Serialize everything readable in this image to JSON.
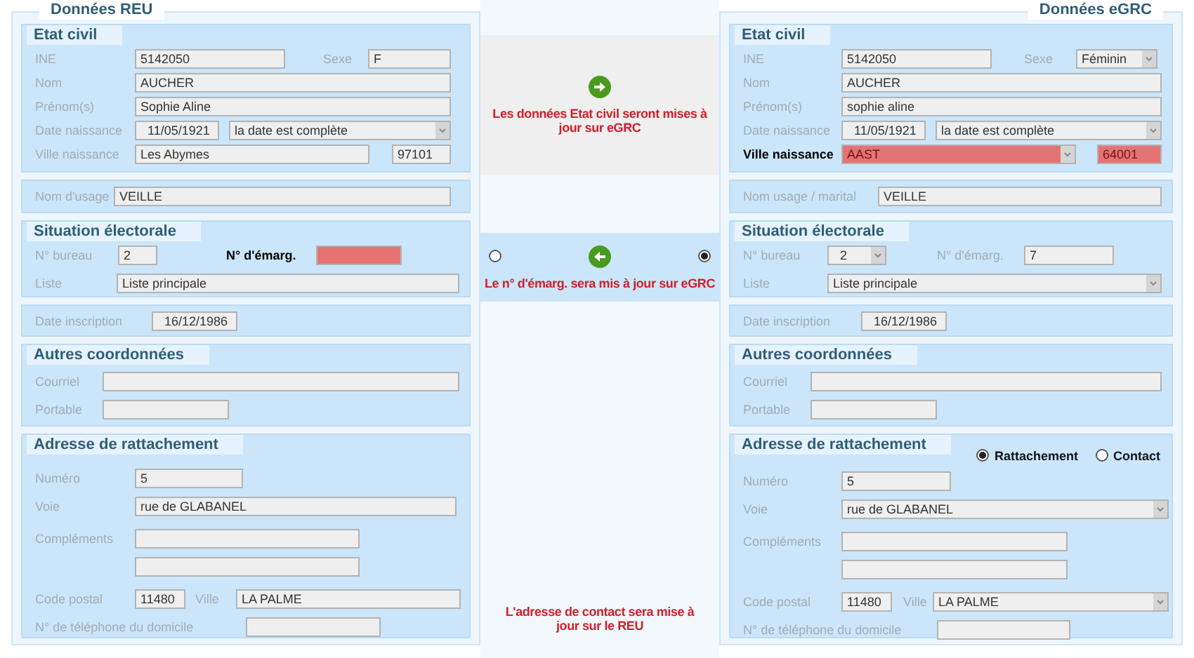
{
  "reu": {
    "title": "Données REU",
    "etat_civil": {
      "title": "Etat civil",
      "ine": {
        "label": "INE",
        "value": "5142050"
      },
      "sexe": {
        "label": "Sexe",
        "value": "F"
      },
      "nom": {
        "label": "Nom",
        "value": "AUCHER"
      },
      "prenoms": {
        "label": "Prénom(s)",
        "value": "Sophie Aline"
      },
      "date_naissance": {
        "label": "Date naissance",
        "value": "11/05/1921",
        "precision": "la date est complète"
      },
      "ville_naissance": {
        "label": "Ville naissance",
        "value": "Les Abymes",
        "code": "97101",
        "highlighted": false
      }
    },
    "nom_usage": {
      "label": "Nom d'usage",
      "value": "VEILLE"
    },
    "situation": {
      "title": "Situation électorale",
      "bureau": {
        "label": "N° bureau",
        "value": "2"
      },
      "emargement": {
        "label": "N° d'émarg.",
        "highlighted": true
      },
      "liste": {
        "label": "Liste",
        "value": "Liste principale"
      }
    },
    "date_inscription": {
      "label": "Date inscription",
      "value": "16/12/1986"
    },
    "autres": {
      "title": "Autres coordonnées",
      "courriel": {
        "label": "Courriel"
      },
      "portable": {
        "label": "Portable"
      }
    },
    "adresse": {
      "title": "Adresse de rattachement",
      "numero": {
        "label": "Numéro",
        "value": "5"
      },
      "voie": {
        "label": "Voie",
        "value": "rue de GLABANEL"
      },
      "complements": {
        "label": "Compléments"
      },
      "code_postal": {
        "label": "Code postal",
        "value": "11480"
      },
      "ville": {
        "label": "Ville",
        "value": "LA PALME"
      },
      "telephone": {
        "label": "N° de téléphone du domicile"
      }
    }
  },
  "actions": {
    "etat_civil": {
      "message": "Les données Etat civil seront mises à jour sur eGRC"
    },
    "emargement": {
      "message": "Le n° d'émarg. sera mis à jour sur eGRC",
      "options": [
        {
          "selected": false
        },
        {
          "selected": true
        }
      ]
    },
    "adresse": {
      "message": "L'adresse de contact sera mise à jour sur le REU"
    }
  },
  "egrc": {
    "title": "Données eGRC",
    "etat_civil": {
      "title": "Etat civil",
      "ine": {
        "label": "INE",
        "value": "5142050"
      },
      "sexe": {
        "label": "Sexe",
        "value": "Féminin",
        "kind": "select"
      },
      "nom": {
        "label": "Nom",
        "value": "AUCHER"
      },
      "prenoms": {
        "label": "Prénom(s)",
        "value": "sophie aline"
      },
      "date_naissance": {
        "label": "Date naissance",
        "value": "11/05/1921",
        "precision": "la date est complète"
      },
      "ville_naissance": {
        "label": "Ville naissance",
        "value": "AAST",
        "code": "64001",
        "kind": "select",
        "highlighted": true
      }
    },
    "nom_usage": {
      "label": "Nom usage / marital",
      "value": "VEILLE"
    },
    "situation": {
      "title": "Situation électorale",
      "bureau": {
        "label": "N° bureau",
        "value": "2",
        "kind": "select"
      },
      "emargement": {
        "label": "N° d'émarg.",
        "value": "7",
        "highlighted": false
      },
      "liste": {
        "label": "Liste",
        "value": "Liste principale",
        "kind": "select"
      }
    },
    "date_inscription": {
      "label": "Date inscription",
      "value": "16/12/1986"
    },
    "autres": {
      "title": "Autres coordonnées",
      "courriel": {
        "label": "Courriel"
      },
      "portable": {
        "label": "Portable"
      }
    },
    "adresse": {
      "title": "Adresse de rattachement",
      "address_type": [
        {
          "label": "Rattachement",
          "selected": true
        },
        {
          "label": "Contact",
          "selected": false
        }
      ],
      "numero": {
        "label": "Numéro",
        "value": "5"
      },
      "voie": {
        "label": "Voie",
        "value": "rue de GLABANEL",
        "kind": "select"
      },
      "complements": {
        "label": "Compléments"
      },
      "code_postal": {
        "label": "Code postal",
        "value": "11480"
      },
      "ville": {
        "label": "Ville",
        "value": "LA PALME",
        "kind": "select"
      },
      "telephone": {
        "label": "N° de téléphone du domicile"
      }
    }
  }
}
